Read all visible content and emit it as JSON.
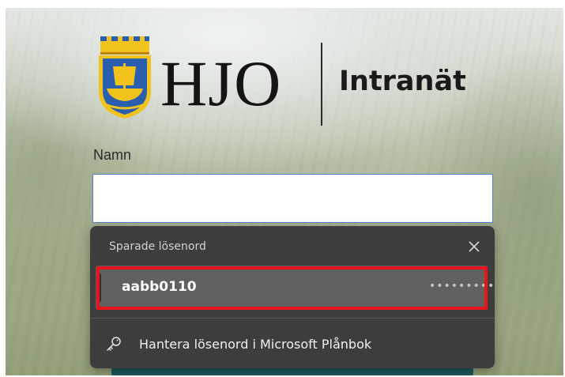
{
  "brand": {
    "name": "HJO",
    "subtitle": "Intranät",
    "crest_icon": "hjo-crest-ship-icon",
    "colors": {
      "crest_blue": "#2a5fb0",
      "crest_gold": "#f2c21c"
    }
  },
  "form": {
    "name_label": "Namn",
    "name_value": "",
    "accent": "#1e5a5b"
  },
  "saved_passwords": {
    "title": "Sparade lösenord",
    "close_icon": "close-icon",
    "items": [
      {
        "username": "aabb0110",
        "password_mask": "•••••••••",
        "highlighted": true
      }
    ],
    "manage_label": "Hantera lösenord i Microsoft Plånbok",
    "manage_icon": "key-icon",
    "highlight_color": "#e8141c"
  }
}
